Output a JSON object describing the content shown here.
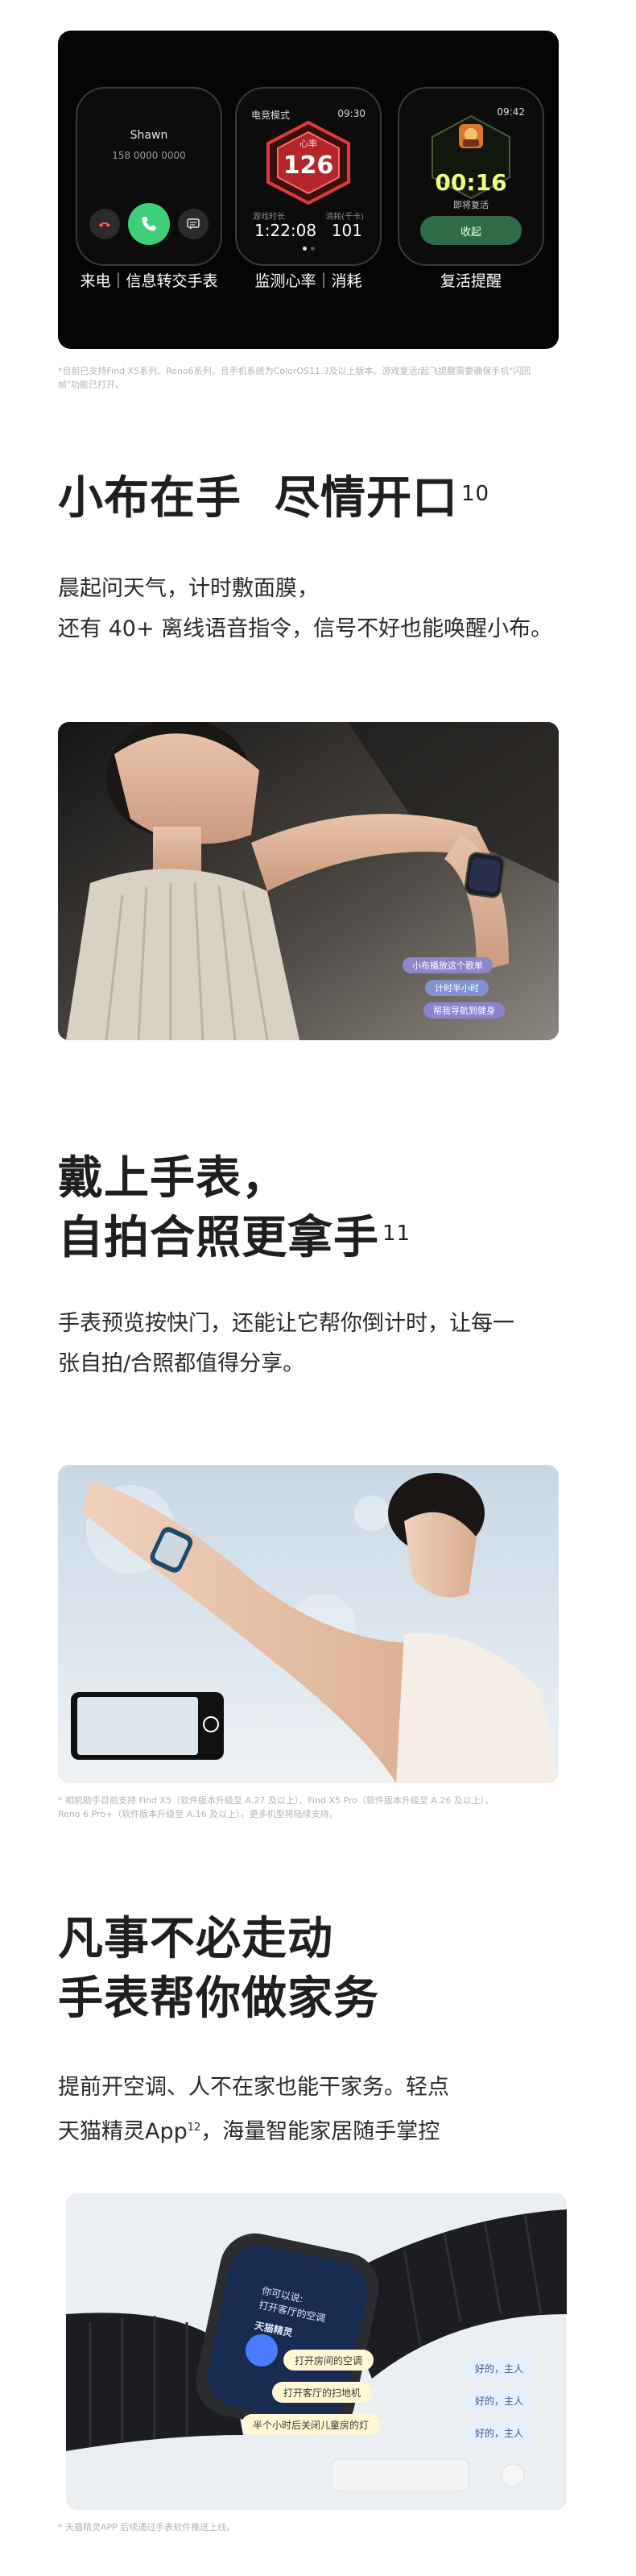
{
  "feature_card": {
    "watch1": {
      "name": "Shawn",
      "number": "158 0000 0000",
      "caption": "来电｜信息转交手表"
    },
    "watch2": {
      "mode": "电竞模式",
      "time": "09:30",
      "heart_label": "心率",
      "heart_value": "126",
      "stat1_label": "游戏时长",
      "stat2_label": "消耗(千卡)",
      "stat1_value": "1:22:08",
      "stat2_value": "101",
      "caption": "监测心率｜消耗"
    },
    "watch3": {
      "time": "09:42",
      "timer": "00:16",
      "sub": "即将复活",
      "button": "收起",
      "caption": "复活提醒"
    }
  },
  "footnote1": "*目前已支持Find X5系列、Reno6系列，且手机系统为ColorOS11.3及以上版本。游戏复活/起飞提醒需要确保手机\"闪回帧\"功能已打开。",
  "section2": {
    "heading": "小布在手  尽情开口",
    "sup": "10",
    "body_line1": "晨起问天气，计时敷面膜，",
    "body_line2": "还有 40+ 离线语音指令，信号不好也能唤醒小布。",
    "chips": [
      "小布播放这个歌单",
      "计时半小时",
      "帮我导航到健身"
    ]
  },
  "section3": {
    "heading_line1": "戴上手表，",
    "heading_line2": "自拍合照更拿手",
    "sup": "11",
    "body_line1": "手表预览按快门，还能让它帮你倒计时，让每一",
    "body_line2": "张自拍/合照都值得分享。"
  },
  "footnote2_line1": "* 相机助手目前支持 Find X5（软件版本升级至 A.27 及以上）、Find X5 Pro（软件版本升级至 A.26 及以上）、",
  "footnote2_line2": "Reno 6 Pro+（软件版本升级至 A.16 及以上），更多机型将陆续支持。",
  "section4": {
    "heading_line1": "凡事不必走动",
    "heading_line2": "手表帮你做家务",
    "body_line1": "提前开空调、人不在家也能干家务。轻点",
    "body_line2_a": "天猫精灵App",
    "body_sup": "12",
    "body_line2_b": "，海量智能家居随手掌控",
    "watch_screen_line1": "你可以说:",
    "watch_screen_line2": "打开客厅的空调",
    "watch_screen_line3": "天猫精灵",
    "commands": [
      "打开房间的空调",
      "打开客厅的扫地机",
      "半个小时后关闭儿童房的灯"
    ],
    "replies": [
      "好的，主人",
      "好的，主人",
      "好的，主人"
    ]
  },
  "footnote3": "* 天猫精灵APP 后续通过手表软件推送上线。",
  "colors": {
    "accent_green": "#3fcf7a",
    "heart_red": "#e23a3a",
    "timer_yellow": "#f2ff7a"
  }
}
